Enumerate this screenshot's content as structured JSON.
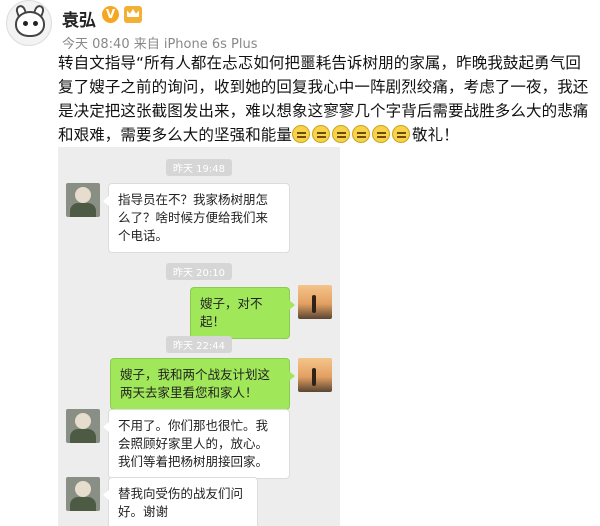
{
  "post": {
    "author": "袁弘",
    "verified_badge": "V",
    "meta": "今天 08:40 来自 iPhone 6s Plus",
    "text": "转自文指导“所有人都在忐忑如何把噩耗告诉树朋的家属，昨晚我鼓起勇气回复了嫂子之前的询问，收到她的回复我心中一阵剧烈绞痛，考虑了一夜，我还是决定把这张截图发出来，难以想象这寥寥几个字背后需要战胜多么大的悲痛和艰难，需要多么大的坚强和能量",
    "text_tail": "敬礼！",
    "emoji_count": 6
  },
  "chat": {
    "timestamps": [
      "昨天 19:48",
      "昨天 20:10",
      "昨天 22:44"
    ],
    "messages": [
      {
        "side": "left",
        "text": "指导员在不？我家杨树朋怎么了？啥时候方便给我们来个电话。"
      },
      {
        "side": "right",
        "text": "嫂子，对不起！"
      },
      {
        "side": "right",
        "text": "嫂子，我和两个战友计划这两天去家里看您和家人！"
      },
      {
        "side": "left",
        "text": "不用了。你们那也很忙。我会照顾好家里人的，放心。我们等着把杨树朋接回家。"
      },
      {
        "side": "left",
        "text": "替我向受伤的战友们问好。谢谢"
      }
    ]
  }
}
